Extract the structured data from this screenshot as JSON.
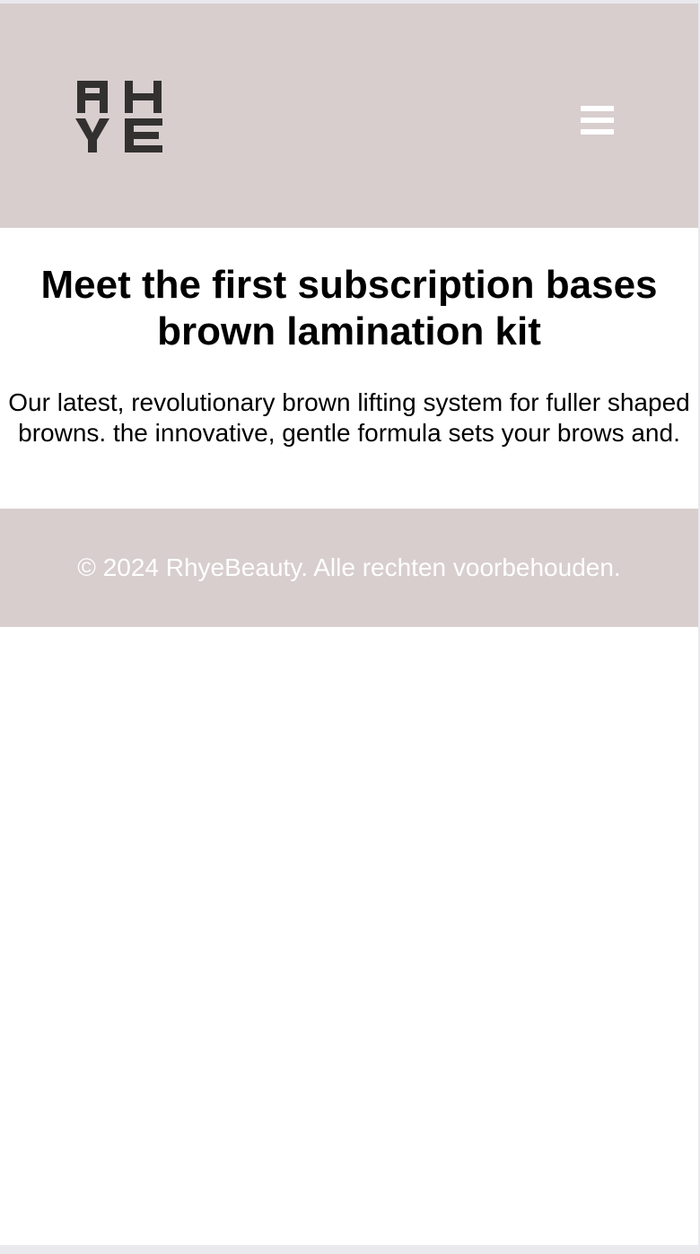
{
  "colors": {
    "header_bg": "#d8cece",
    "footer_bg": "#d8cece",
    "logo": "#333130",
    "menu_icon": "#ffffff",
    "text": "#000000",
    "footer_text": "#ffffff"
  },
  "header": {
    "logo_text": "RHYE",
    "menu_icon": "hamburger-menu-icon"
  },
  "hero": {
    "title": "Meet the first subscription bases brown lamination kit",
    "text": "Our latest, revolutionary brown lifting system for fuller shaped browns. the innovative, gentle formula sets your brows and."
  },
  "footer": {
    "copyright": "© 2024 RhyeBeauty. Alle rechten voorbehouden."
  }
}
